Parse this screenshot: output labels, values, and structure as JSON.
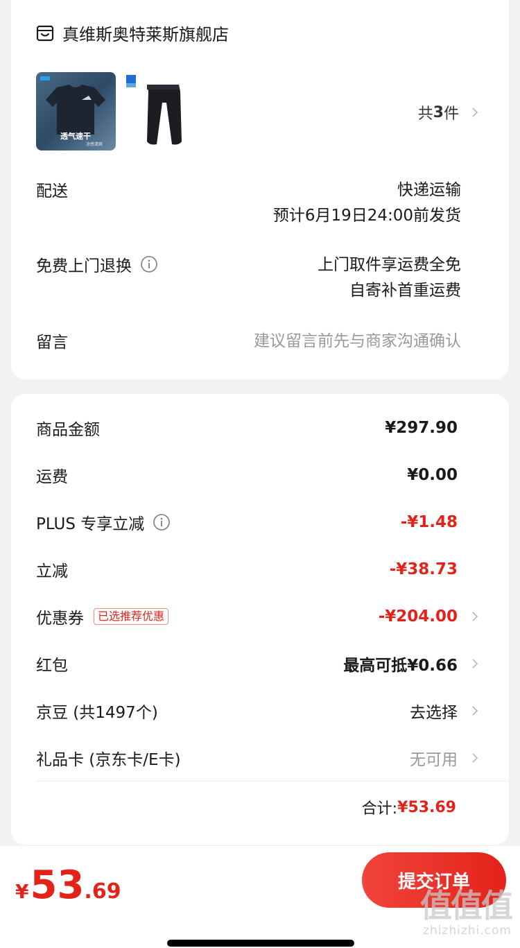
{
  "store": {
    "name": "真维斯奥特莱斯旗舰店",
    "icon": "store-icon",
    "item_count_prefix": "共",
    "item_count": "3",
    "item_count_suffix": "件",
    "thumb1_text": "透气速干",
    "thumb1_subtext": "凉感清爽"
  },
  "order_info": {
    "delivery": {
      "label": "配送",
      "line1": "快递运输",
      "line2": "预计6月19日24:00前发货"
    },
    "return": {
      "label": "免费上门退换",
      "line1": "上门取件享运费全免",
      "line2": "自寄补首重运费"
    },
    "message": {
      "label": "留言",
      "placeholder": "建议留言前先与商家沟通确认"
    }
  },
  "price": {
    "goods": {
      "label": "商品金额",
      "value": "¥297.90"
    },
    "shipping": {
      "label": "运费",
      "value": "¥0.00"
    },
    "plus": {
      "label": "PLUS 专享立减",
      "value": "-¥1.48"
    },
    "instant": {
      "label": "立减",
      "value": "-¥38.73"
    },
    "coupon": {
      "label": "优惠券",
      "tag": "已选推荐优惠",
      "value": "-¥204.00"
    },
    "redpacket": {
      "label": "红包",
      "value": "最高可抵¥0.66"
    },
    "jingdou": {
      "label": "京豆 (共1497个)",
      "value": "去选择"
    },
    "giftcard": {
      "label": "礼品卡 (京东卡/E卡)",
      "value": "无可用"
    },
    "total_label": "合计:",
    "total_value": "¥53.69"
  },
  "bottom": {
    "yen": "¥",
    "int": "53",
    "dec": ".69",
    "submit_label": "提交订单"
  },
  "watermark": {
    "mark": "值值值",
    "url": "zhizhizhi.com"
  },
  "colors": {
    "accent": "#e2231a",
    "background": "#f2f2f2",
    "card": "#ffffff"
  }
}
